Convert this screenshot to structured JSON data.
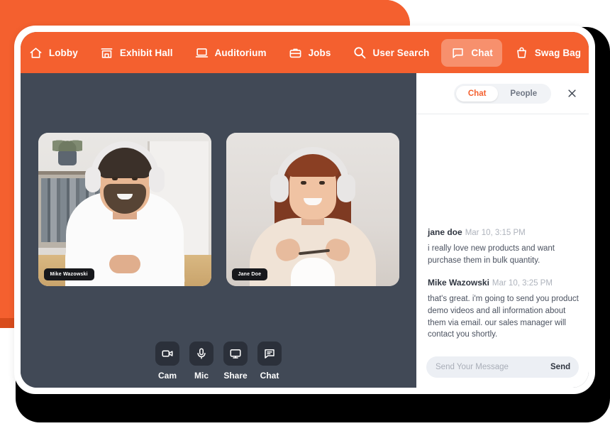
{
  "nav": {
    "items": [
      {
        "label": "Lobby",
        "icon": "home-icon",
        "active": false
      },
      {
        "label": "Exhibit Hall",
        "icon": "store-icon",
        "active": false
      },
      {
        "label": "Auditorium",
        "icon": "laptop-icon",
        "active": false
      },
      {
        "label": "Jobs",
        "icon": "briefcase-icon",
        "active": false
      },
      {
        "label": "User Search",
        "icon": "search-icon",
        "active": false
      },
      {
        "label": "Chat",
        "icon": "chat-bubble-icon",
        "active": true
      },
      {
        "label": "Swag Bag",
        "icon": "bag-icon",
        "active": false
      }
    ]
  },
  "stage": {
    "participants": [
      {
        "name": "Mike Wazowski"
      },
      {
        "name": "Jane Doe"
      }
    ],
    "controls": [
      {
        "label": "Cam",
        "icon": "video-camera-icon"
      },
      {
        "label": "Mic",
        "icon": "microphone-icon"
      },
      {
        "label": "Share",
        "icon": "monitor-icon"
      },
      {
        "label": "Chat",
        "icon": "chat-bubble-icon"
      }
    ]
  },
  "chat": {
    "tabs": [
      {
        "label": "Chat",
        "active": true
      },
      {
        "label": "People",
        "active": false
      }
    ],
    "close_icon": "close-icon",
    "messages": [
      {
        "author": "jane doe",
        "time": "Mar 10, 3:15 PM",
        "text": "i really love new products and want purchase them in bulk quantity."
      },
      {
        "author": "Mike Wazowski",
        "time": "Mar 10, 3:25 PM",
        "text": "that's great. i'm going to send you product demo videos and all information about them via email. our sales manager will contact you shortly."
      }
    ],
    "composer": {
      "value": "",
      "placeholder": "Send Your Message",
      "send_label": "Send"
    }
  },
  "theme": {
    "orange": "#f4602f",
    "orange_dark": "#d84c1c",
    "slate": "#414956",
    "control": "#2b303a"
  }
}
